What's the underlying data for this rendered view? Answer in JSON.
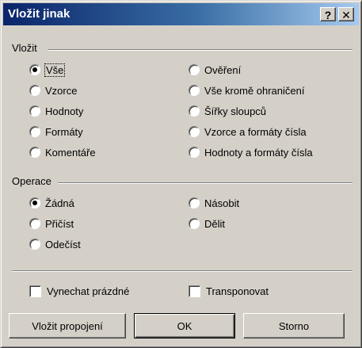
{
  "dialog": {
    "title": "Vložit jinak",
    "help_label": "?",
    "close_label": "✕"
  },
  "paste_group": {
    "label": "Vložit",
    "options": [
      {
        "label": "Vše",
        "checked": true
      },
      {
        "label": "Vzorce",
        "checked": false
      },
      {
        "label": "Hodnoty",
        "checked": false
      },
      {
        "label": "Formáty",
        "checked": false
      },
      {
        "label": "Komentáře",
        "checked": false
      },
      {
        "label": "Ověření",
        "checked": false
      },
      {
        "label": "Vše kromě ohraničení",
        "checked": false
      },
      {
        "label": "Šířky sloupců",
        "checked": false
      },
      {
        "label": "Vzorce a formáty čísla",
        "checked": false
      },
      {
        "label": "Hodnoty a formáty čísla",
        "checked": false
      }
    ]
  },
  "operation_group": {
    "label": "Operace",
    "options": [
      {
        "label": "Žádná",
        "checked": true
      },
      {
        "label": "Přičíst",
        "checked": false
      },
      {
        "label": "Odečíst",
        "checked": false
      },
      {
        "label": "Násobit",
        "checked": false
      },
      {
        "label": "Dělit",
        "checked": false
      }
    ]
  },
  "checkboxes": {
    "skip_blanks": {
      "label": "Vynechat prázdné",
      "checked": false
    },
    "transpose": {
      "label": "Transponovat",
      "checked": false
    }
  },
  "buttons": {
    "paste_link": "Vložit propojení",
    "ok": "OK",
    "cancel": "Storno"
  }
}
